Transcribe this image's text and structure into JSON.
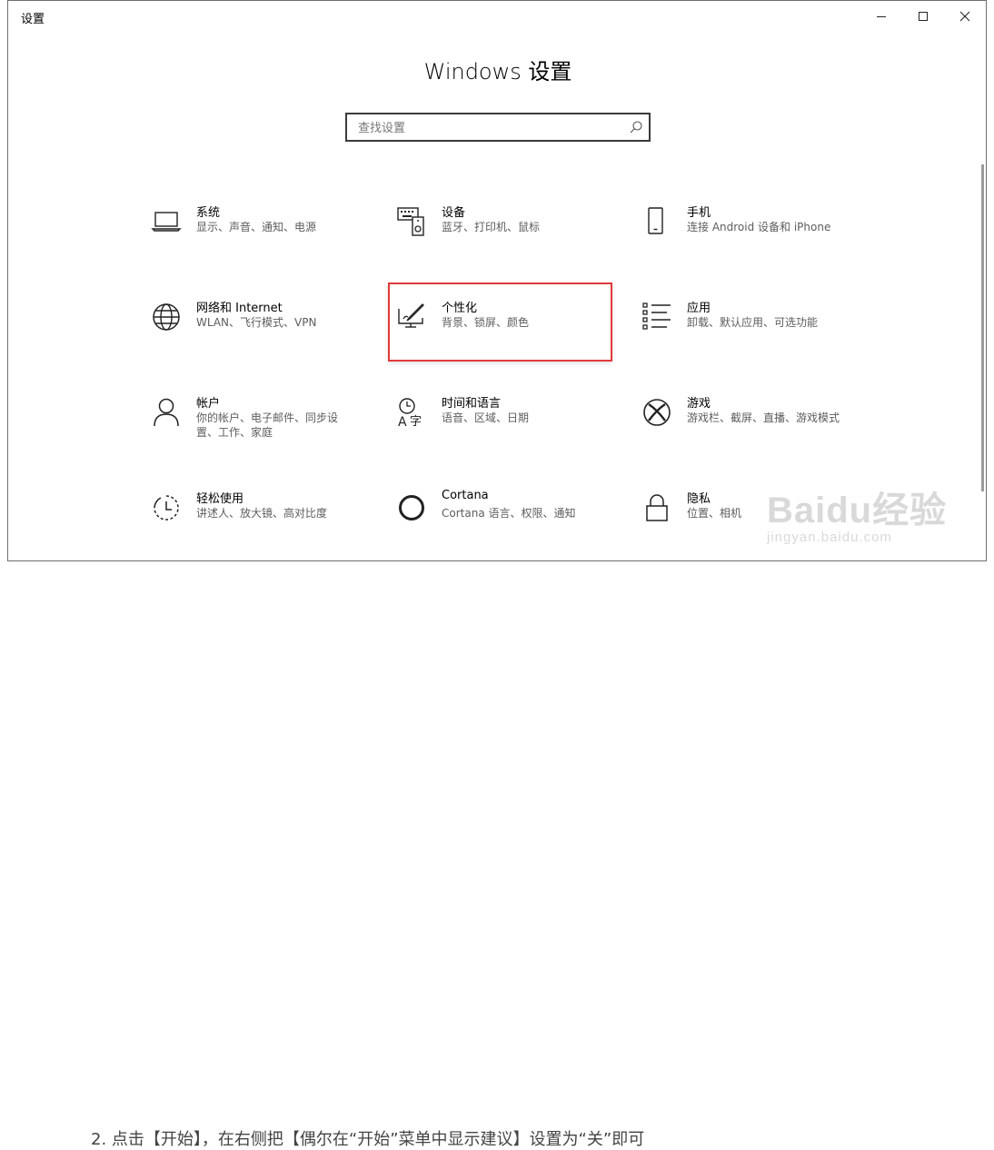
{
  "window": {
    "title": "设置",
    "main_title": "Windows 设置"
  },
  "search": {
    "placeholder": "查找设置"
  },
  "tiles": [
    {
      "name": "系统",
      "desc": "显示、声音、通知、电源",
      "icon": "laptop-icon"
    },
    {
      "name": "设备",
      "desc": "蓝牙、打印机、鼠标",
      "icon": "devices-icon"
    },
    {
      "name": "手机",
      "desc": "连接 Android 设备和 iPhone",
      "icon": "phone-icon"
    },
    {
      "name": "网络和 Internet",
      "desc": "WLAN、飞行模式、VPN",
      "icon": "globe-icon"
    },
    {
      "name": "个性化",
      "desc": "背景、锁屏、颜色",
      "icon": "personalization-icon"
    },
    {
      "name": "应用",
      "desc": "卸载、默认应用、可选功能",
      "icon": "apps-list-icon"
    },
    {
      "name": "帐户",
      "desc": "你的帐户、电子邮件、同步设置、工作、家庭",
      "icon": "person-icon"
    },
    {
      "name": "时间和语言",
      "desc": "语音、区域、日期",
      "icon": "time-language-icon"
    },
    {
      "name": "游戏",
      "desc": "游戏栏、截屏、直播、游戏模式",
      "icon": "xbox-icon"
    },
    {
      "name": "轻松使用",
      "desc": "讲述人、放大镜、高对比度",
      "icon": "ease-of-access-icon"
    },
    {
      "name": "Cortana",
      "desc": "Cortana 语言、权限、通知",
      "icon": "cortana-icon"
    },
    {
      "name": "隐私",
      "desc": "位置、相机",
      "icon": "lock-icon"
    }
  ],
  "background": {
    "bottom_text": "2. 点击【开始】，在右侧把【偶尔在“开始”菜单中显示建议】设置为“关”即可",
    "watermark_brand": "Baidu经验",
    "watermark_url": "jingyan.baidu.com"
  },
  "colors": {
    "highlight": "#e03a3a",
    "accent": "#000000"
  }
}
